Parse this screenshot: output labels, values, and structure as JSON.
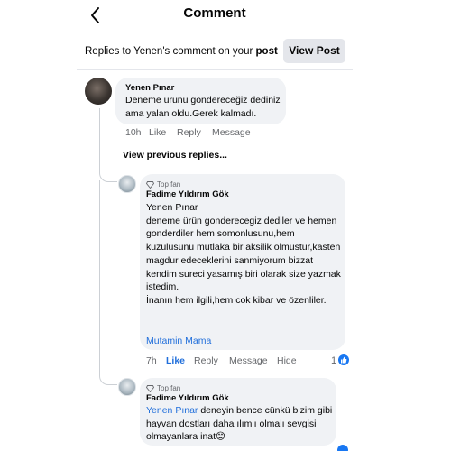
{
  "header": {
    "title": "Comment",
    "back_icon": "chevron-left-icon"
  },
  "banner": {
    "prefix": "Replies to Yenen's comment on your ",
    "post_word": "post",
    "view_post_label": "View Post"
  },
  "comments": [
    {
      "author": "Yenen Pınar",
      "text": "Deneme ürünü göndereceğiz dediniz ama yalan oldu.Gerek kalmadı.",
      "time": "10h",
      "like_label": "Like",
      "reply_label": "Reply",
      "message_label": "Message"
    }
  ],
  "view_previous_label": "View previous replies...",
  "replies": [
    {
      "badge": "Top fan",
      "author": "Fadime Yıldırım Gök",
      "text": "Yenen Pınar\n deneme ürün gonderecegiz dediler ve hemen gonderdiler hem somonlusunu,hem kuzulusunu mutlaka bir aksilik olmustur,kasten magdur edeceklerini sanmiyorum bizzat kendim sureci yasamış biri olarak size yazmak istedim.\nİnanın hem ilgili,hem cok kibar ve özenliler.",
      "mention": "Mutamin Mama",
      "time": "7h",
      "like_label": "Like",
      "reply_label": "Reply",
      "message_label": "Message",
      "hide_label": "Hide",
      "reaction_count": "1"
    },
    {
      "badge": "Top fan",
      "author": "Fadime Yıldırım Gök",
      "mention": "Yenen Pınar",
      "text": " deneyin bence cünkü bizim gibi hayvan dostları daha ılımlı olmalı sevgisi olmayanlara inat😊"
    }
  ],
  "colors": {
    "accent": "#216fdb",
    "bubble": "#f0f2f5",
    "muted": "#65676b"
  }
}
